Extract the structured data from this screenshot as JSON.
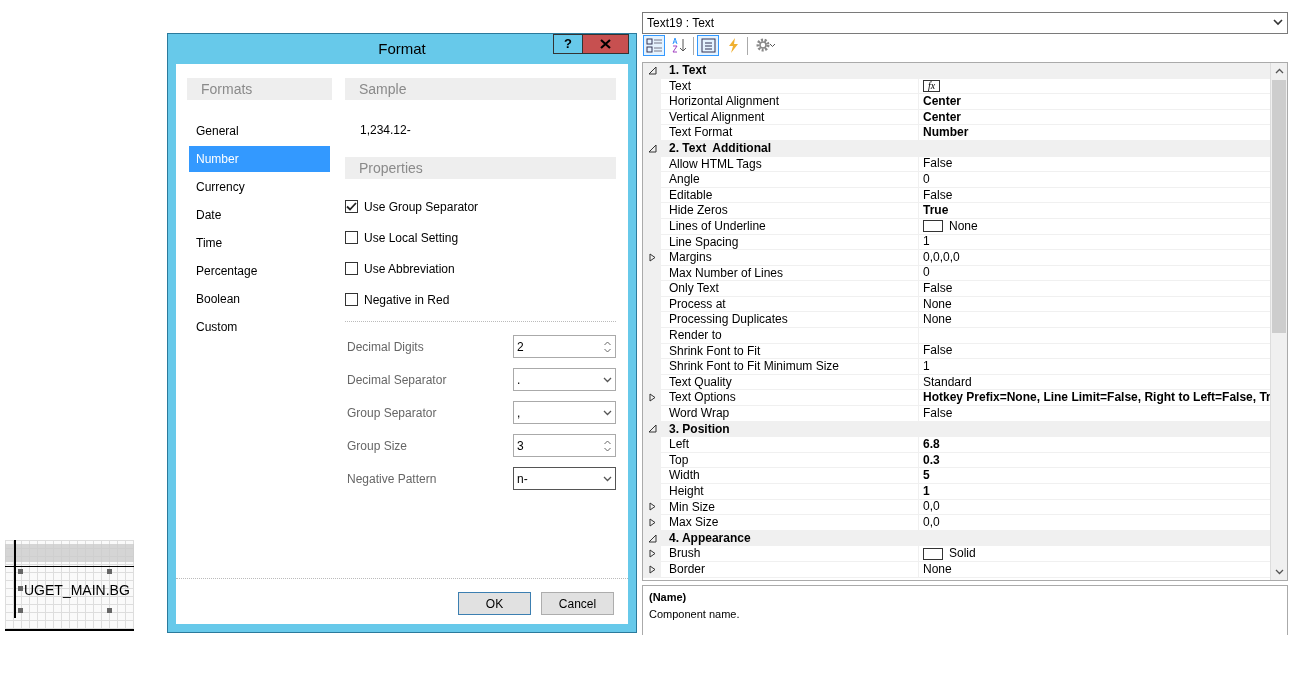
{
  "designer": {
    "field_text": "UGET_MAIN.BG"
  },
  "format_dialog": {
    "title": "Format",
    "help_button": "?",
    "formats_header": "Formats",
    "formats": [
      {
        "label": "General",
        "selected": false
      },
      {
        "label": "Number",
        "selected": true
      },
      {
        "label": "Currency",
        "selected": false
      },
      {
        "label": "Date",
        "selected": false
      },
      {
        "label": "Time",
        "selected": false
      },
      {
        "label": "Percentage",
        "selected": false
      },
      {
        "label": "Boolean",
        "selected": false
      },
      {
        "label": "Custom",
        "selected": false
      }
    ],
    "sample_header": "Sample",
    "sample": "1,234.12-",
    "properties_header": "Properties",
    "options": [
      {
        "label": "Use Group Separator",
        "checked": true
      },
      {
        "label": "Use Local Setting",
        "checked": false
      },
      {
        "label": "Use Abbreviation",
        "checked": false
      },
      {
        "label": "Negative in Red",
        "checked": false
      }
    ],
    "fields": [
      {
        "label": "Decimal Digits",
        "kind": "spin",
        "value": "2"
      },
      {
        "label": "Decimal Separator",
        "kind": "combo",
        "value": "."
      },
      {
        "label": "Group Separator",
        "kind": "combo",
        "value": ","
      },
      {
        "label": "Group Size",
        "kind": "spin",
        "value": "3"
      },
      {
        "label": "Negative Pattern",
        "kind": "combo",
        "value": "n-"
      }
    ],
    "buttons": [
      "OK",
      "Cancel"
    ]
  },
  "properties_panel": {
    "object_selector": "Text19 : Text",
    "toolbar": [
      {
        "kind": "categorized",
        "selected": true
      },
      {
        "kind": "alphabetical",
        "selected": false
      },
      {
        "kind": "properties",
        "selected": true
      },
      {
        "kind": "events",
        "selected": false
      },
      {
        "kind": "settings",
        "selected": false
      }
    ],
    "categories": [
      {
        "title": "1. Text",
        "expanded": true,
        "rows": [
          {
            "name": "Text",
            "kind": "expression",
            "value": "fx",
            "expandable": false
          },
          {
            "name": "Horizontal Alignment",
            "kind": "text",
            "value": "Center",
            "modified": true,
            "expandable": false
          },
          {
            "name": "Vertical Alignment",
            "kind": "text",
            "value": "Center",
            "modified": true,
            "expandable": false
          },
          {
            "name": "Text Format",
            "kind": "text",
            "value": "Number",
            "modified": true,
            "expandable": false
          }
        ]
      },
      {
        "title": "2. Text  Additional",
        "expanded": true,
        "rows": [
          {
            "name": "Allow HTML Tags",
            "kind": "text",
            "value": "False",
            "modified": false,
            "expandable": false
          },
          {
            "name": "Angle",
            "kind": "text",
            "value": "0",
            "modified": false,
            "expandable": false
          },
          {
            "name": "Editable",
            "kind": "text",
            "value": "False",
            "modified": false,
            "expandable": false
          },
          {
            "name": "Hide Zeros",
            "kind": "text",
            "value": "True",
            "modified": true,
            "expandable": false
          },
          {
            "name": "Lines of Underline",
            "kind": "swatch",
            "value": "None",
            "modified": false,
            "expandable": false
          },
          {
            "name": "Line Spacing",
            "kind": "text",
            "value": "1",
            "modified": false,
            "expandable": false
          },
          {
            "name": "Margins",
            "kind": "text",
            "value": "0,0,0,0",
            "modified": false,
            "expandable": true
          },
          {
            "name": "Max Number of Lines",
            "kind": "text",
            "value": "0",
            "modified": false,
            "expandable": false
          },
          {
            "name": "Only Text",
            "kind": "text",
            "value": "False",
            "modified": false,
            "expandable": false
          },
          {
            "name": "Process at",
            "kind": "text",
            "value": "None",
            "modified": false,
            "expandable": false
          },
          {
            "name": "Processing Duplicates",
            "kind": "text",
            "value": "None",
            "modified": false,
            "expandable": false
          },
          {
            "name": "Render to",
            "kind": "text",
            "expandable": false
          },
          {
            "name": "Shrink Font to Fit",
            "kind": "text",
            "value": "False",
            "modified": false,
            "expandable": false
          },
          {
            "name": "Shrink Font to Fit Minimum Size",
            "kind": "text",
            "value": "1",
            "modified": false,
            "expandable": false
          },
          {
            "name": "Text Quality",
            "kind": "text",
            "value": "Standard",
            "modified": false,
            "expandable": false
          },
          {
            "name": "Text Options",
            "kind": "text",
            "value": "Hotkey Prefix=None, Line Limit=False, Right to Left=False, Tr",
            "modified": true,
            "expandable": true
          },
          {
            "name": "Word Wrap",
            "kind": "text",
            "value": "False",
            "modified": false,
            "expandable": false
          }
        ]
      },
      {
        "title": "3. Position",
        "expanded": true,
        "rows": [
          {
            "name": "Left",
            "kind": "text",
            "value": "6.8",
            "modified": true,
            "expandable": false
          },
          {
            "name": "Top",
            "kind": "text",
            "value": "0.3",
            "modified": true,
            "expandable": false
          },
          {
            "name": "Width",
            "kind": "text",
            "value": "5",
            "modified": true,
            "expandable": false
          },
          {
            "name": "Height",
            "kind": "text",
            "value": "1",
            "modified": true,
            "expandable": false
          },
          {
            "name": "Min Size",
            "kind": "text",
            "value": "0,0",
            "modified": false,
            "expandable": true
          },
          {
            "name": "Max Size",
            "kind": "text",
            "value": "0,0",
            "modified": false,
            "expandable": true
          }
        ]
      },
      {
        "title": "4. Appearance",
        "expanded": true,
        "rows": [
          {
            "name": "Brush",
            "kind": "swatch",
            "value": "Solid",
            "modified": false,
            "expandable": true
          },
          {
            "name": "Border",
            "kind": "text",
            "value": "None",
            "modified": false,
            "expandable": true
          }
        ]
      }
    ],
    "description": {
      "title": "(Name)",
      "text": "Component name."
    }
  }
}
